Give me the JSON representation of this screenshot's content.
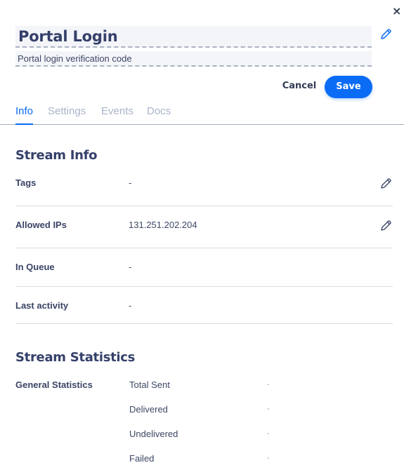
{
  "header": {
    "title": "Portal Login",
    "description": "Portal login verification code",
    "close_icon": "×",
    "cancel_label": "Cancel",
    "save_label": "Save"
  },
  "tabs": [
    {
      "label": "Info",
      "active": true
    },
    {
      "label": "Settings",
      "active": false
    },
    {
      "label": "Events",
      "active": false
    },
    {
      "label": "Docs",
      "active": false
    }
  ],
  "stream_info": {
    "title": "Stream Info",
    "rows": [
      {
        "label": "Tags",
        "value": "-",
        "editable": true
      },
      {
        "label": "Allowed IPs",
        "value": "131.251.202.204",
        "editable": true
      },
      {
        "label": "In Queue",
        "value": "-",
        "editable": false
      },
      {
        "label": "Last activity",
        "value": "-",
        "editable": false
      }
    ]
  },
  "stream_statistics": {
    "title": "Stream Statistics",
    "group_label": "General Statistics",
    "items": [
      {
        "label": "Total Sent",
        "value": "-"
      },
      {
        "label": "Delivered",
        "value": "-"
      },
      {
        "label": "Undelivered",
        "value": "-"
      },
      {
        "label": "Failed",
        "value": "-"
      }
    ]
  },
  "colors": {
    "accent": "#0a6cf5",
    "heading": "#35406a",
    "tab_inactive": "#aab3c8"
  }
}
